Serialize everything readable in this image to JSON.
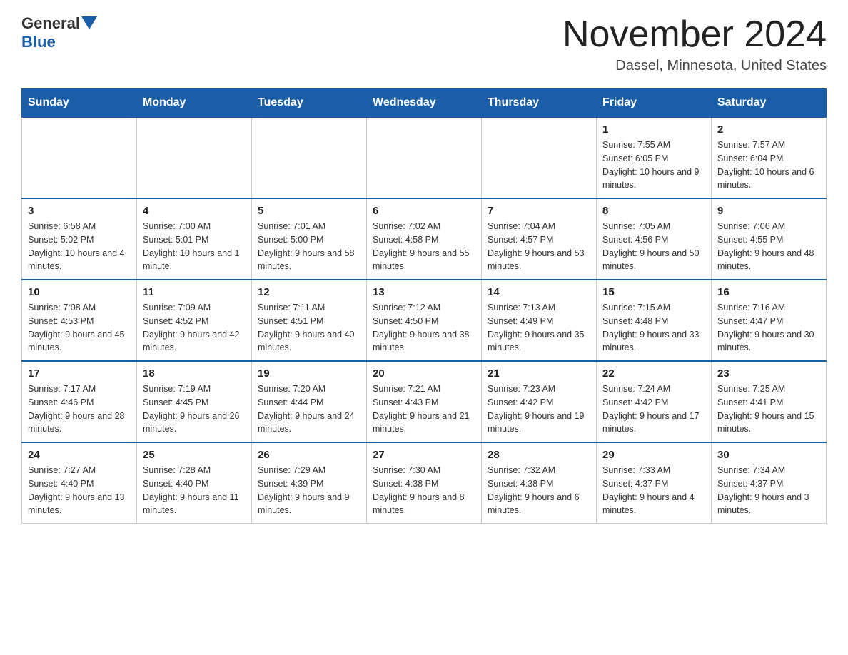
{
  "header": {
    "logo_general": "General",
    "logo_blue": "Blue",
    "month_title": "November 2024",
    "location": "Dassel, Minnesota, United States"
  },
  "days_of_week": [
    "Sunday",
    "Monday",
    "Tuesday",
    "Wednesday",
    "Thursday",
    "Friday",
    "Saturday"
  ],
  "weeks": [
    [
      {
        "day": "",
        "info": ""
      },
      {
        "day": "",
        "info": ""
      },
      {
        "day": "",
        "info": ""
      },
      {
        "day": "",
        "info": ""
      },
      {
        "day": "",
        "info": ""
      },
      {
        "day": "1",
        "info": "Sunrise: 7:55 AM\nSunset: 6:05 PM\nDaylight: 10 hours and 9 minutes."
      },
      {
        "day": "2",
        "info": "Sunrise: 7:57 AM\nSunset: 6:04 PM\nDaylight: 10 hours and 6 minutes."
      }
    ],
    [
      {
        "day": "3",
        "info": "Sunrise: 6:58 AM\nSunset: 5:02 PM\nDaylight: 10 hours and 4 minutes."
      },
      {
        "day": "4",
        "info": "Sunrise: 7:00 AM\nSunset: 5:01 PM\nDaylight: 10 hours and 1 minute."
      },
      {
        "day": "5",
        "info": "Sunrise: 7:01 AM\nSunset: 5:00 PM\nDaylight: 9 hours and 58 minutes."
      },
      {
        "day": "6",
        "info": "Sunrise: 7:02 AM\nSunset: 4:58 PM\nDaylight: 9 hours and 55 minutes."
      },
      {
        "day": "7",
        "info": "Sunrise: 7:04 AM\nSunset: 4:57 PM\nDaylight: 9 hours and 53 minutes."
      },
      {
        "day": "8",
        "info": "Sunrise: 7:05 AM\nSunset: 4:56 PM\nDaylight: 9 hours and 50 minutes."
      },
      {
        "day": "9",
        "info": "Sunrise: 7:06 AM\nSunset: 4:55 PM\nDaylight: 9 hours and 48 minutes."
      }
    ],
    [
      {
        "day": "10",
        "info": "Sunrise: 7:08 AM\nSunset: 4:53 PM\nDaylight: 9 hours and 45 minutes."
      },
      {
        "day": "11",
        "info": "Sunrise: 7:09 AM\nSunset: 4:52 PM\nDaylight: 9 hours and 42 minutes."
      },
      {
        "day": "12",
        "info": "Sunrise: 7:11 AM\nSunset: 4:51 PM\nDaylight: 9 hours and 40 minutes."
      },
      {
        "day": "13",
        "info": "Sunrise: 7:12 AM\nSunset: 4:50 PM\nDaylight: 9 hours and 38 minutes."
      },
      {
        "day": "14",
        "info": "Sunrise: 7:13 AM\nSunset: 4:49 PM\nDaylight: 9 hours and 35 minutes."
      },
      {
        "day": "15",
        "info": "Sunrise: 7:15 AM\nSunset: 4:48 PM\nDaylight: 9 hours and 33 minutes."
      },
      {
        "day": "16",
        "info": "Sunrise: 7:16 AM\nSunset: 4:47 PM\nDaylight: 9 hours and 30 minutes."
      }
    ],
    [
      {
        "day": "17",
        "info": "Sunrise: 7:17 AM\nSunset: 4:46 PM\nDaylight: 9 hours and 28 minutes."
      },
      {
        "day": "18",
        "info": "Sunrise: 7:19 AM\nSunset: 4:45 PM\nDaylight: 9 hours and 26 minutes."
      },
      {
        "day": "19",
        "info": "Sunrise: 7:20 AM\nSunset: 4:44 PM\nDaylight: 9 hours and 24 minutes."
      },
      {
        "day": "20",
        "info": "Sunrise: 7:21 AM\nSunset: 4:43 PM\nDaylight: 9 hours and 21 minutes."
      },
      {
        "day": "21",
        "info": "Sunrise: 7:23 AM\nSunset: 4:42 PM\nDaylight: 9 hours and 19 minutes."
      },
      {
        "day": "22",
        "info": "Sunrise: 7:24 AM\nSunset: 4:42 PM\nDaylight: 9 hours and 17 minutes."
      },
      {
        "day": "23",
        "info": "Sunrise: 7:25 AM\nSunset: 4:41 PM\nDaylight: 9 hours and 15 minutes."
      }
    ],
    [
      {
        "day": "24",
        "info": "Sunrise: 7:27 AM\nSunset: 4:40 PM\nDaylight: 9 hours and 13 minutes."
      },
      {
        "day": "25",
        "info": "Sunrise: 7:28 AM\nSunset: 4:40 PM\nDaylight: 9 hours and 11 minutes."
      },
      {
        "day": "26",
        "info": "Sunrise: 7:29 AM\nSunset: 4:39 PM\nDaylight: 9 hours and 9 minutes."
      },
      {
        "day": "27",
        "info": "Sunrise: 7:30 AM\nSunset: 4:38 PM\nDaylight: 9 hours and 8 minutes."
      },
      {
        "day": "28",
        "info": "Sunrise: 7:32 AM\nSunset: 4:38 PM\nDaylight: 9 hours and 6 minutes."
      },
      {
        "day": "29",
        "info": "Sunrise: 7:33 AM\nSunset: 4:37 PM\nDaylight: 9 hours and 4 minutes."
      },
      {
        "day": "30",
        "info": "Sunrise: 7:34 AM\nSunset: 4:37 PM\nDaylight: 9 hours and 3 minutes."
      }
    ]
  ]
}
